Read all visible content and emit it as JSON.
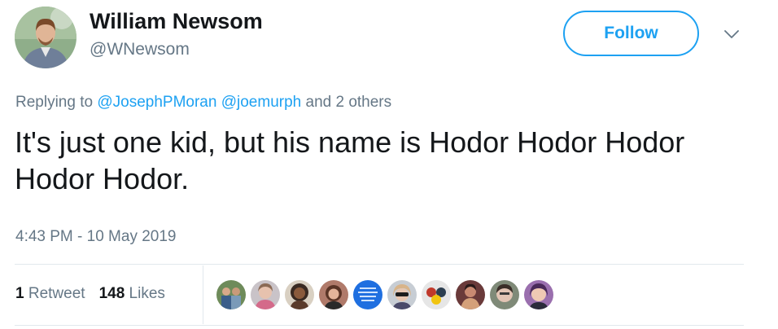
{
  "author": {
    "display_name": "William Newsom",
    "handle": "@WNewsom"
  },
  "follow_button": {
    "label": "Follow",
    "color": "#1da1f2"
  },
  "reply_context": {
    "prefix": "Replying to",
    "mentions": [
      "@JosephPMoran",
      "@joemurph"
    ],
    "suffix": "and 2 others"
  },
  "tweet": {
    "text": "It's just one kid, but his name is Hodor Hodor Hodor Hodor Hodor.",
    "timestamp": "4:43 PM - 10 May 2019"
  },
  "stats": {
    "retweets_count": "1",
    "retweets_label": "Retweet",
    "likes_count": "148",
    "likes_label": "Likes"
  },
  "icons": {
    "more": "chevron-down-icon"
  },
  "colors": {
    "link": "#1da1f2",
    "secondary_text": "#657786",
    "primary_text": "#14171a",
    "divider": "#e1e8ed"
  }
}
